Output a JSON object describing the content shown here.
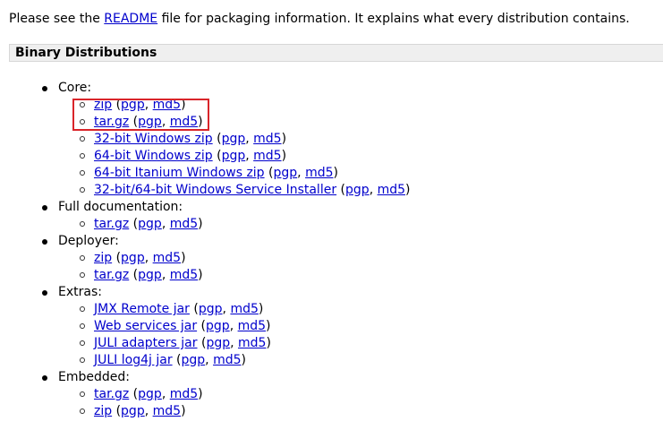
{
  "intro": {
    "before": "Please see the ",
    "link": "README",
    "after": " file for packaging information. It explains what every distribution contains."
  },
  "section": {
    "title": "Binary Distributions"
  },
  "groups": [
    {
      "label": "Core:",
      "items": [
        {
          "name": "zip",
          "pgp": "pgp",
          "md5": "md5"
        },
        {
          "name": "tar.gz",
          "pgp": "pgp",
          "md5": "md5"
        },
        {
          "name": "32-bit Windows zip",
          "pgp": "pgp",
          "md5": "md5"
        },
        {
          "name": "64-bit Windows zip",
          "pgp": "pgp",
          "md5": "md5"
        },
        {
          "name": "64-bit Itanium Windows zip",
          "pgp": "pgp",
          "md5": "md5"
        },
        {
          "name": "32-bit/64-bit Windows Service Installer",
          "pgp": "pgp",
          "md5": "md5"
        }
      ]
    },
    {
      "label": "Full documentation:",
      "items": [
        {
          "name": "tar.gz",
          "pgp": "pgp",
          "md5": "md5"
        }
      ]
    },
    {
      "label": "Deployer:",
      "items": [
        {
          "name": "zip",
          "pgp": "pgp",
          "md5": "md5"
        },
        {
          "name": "tar.gz",
          "pgp": "pgp",
          "md5": "md5"
        }
      ]
    },
    {
      "label": "Extras:",
      "items": [
        {
          "name": "JMX Remote jar",
          "pgp": "pgp",
          "md5": "md5"
        },
        {
          "name": "Web services jar",
          "pgp": "pgp",
          "md5": "md5"
        },
        {
          "name": "JULI adapters jar",
          "pgp": "pgp",
          "md5": "md5"
        },
        {
          "name": "JULI log4j jar",
          "pgp": "pgp",
          "md5": "md5"
        }
      ]
    },
    {
      "label": "Embedded:",
      "items": [
        {
          "name": "tar.gz",
          "pgp": "pgp",
          "md5": "md5"
        },
        {
          "name": "zip",
          "pgp": "pgp",
          "md5": "md5"
        }
      ]
    }
  ],
  "colors": {
    "link": "#0000cc",
    "highlight": "#d9252a",
    "header_bg": "#efefef"
  }
}
